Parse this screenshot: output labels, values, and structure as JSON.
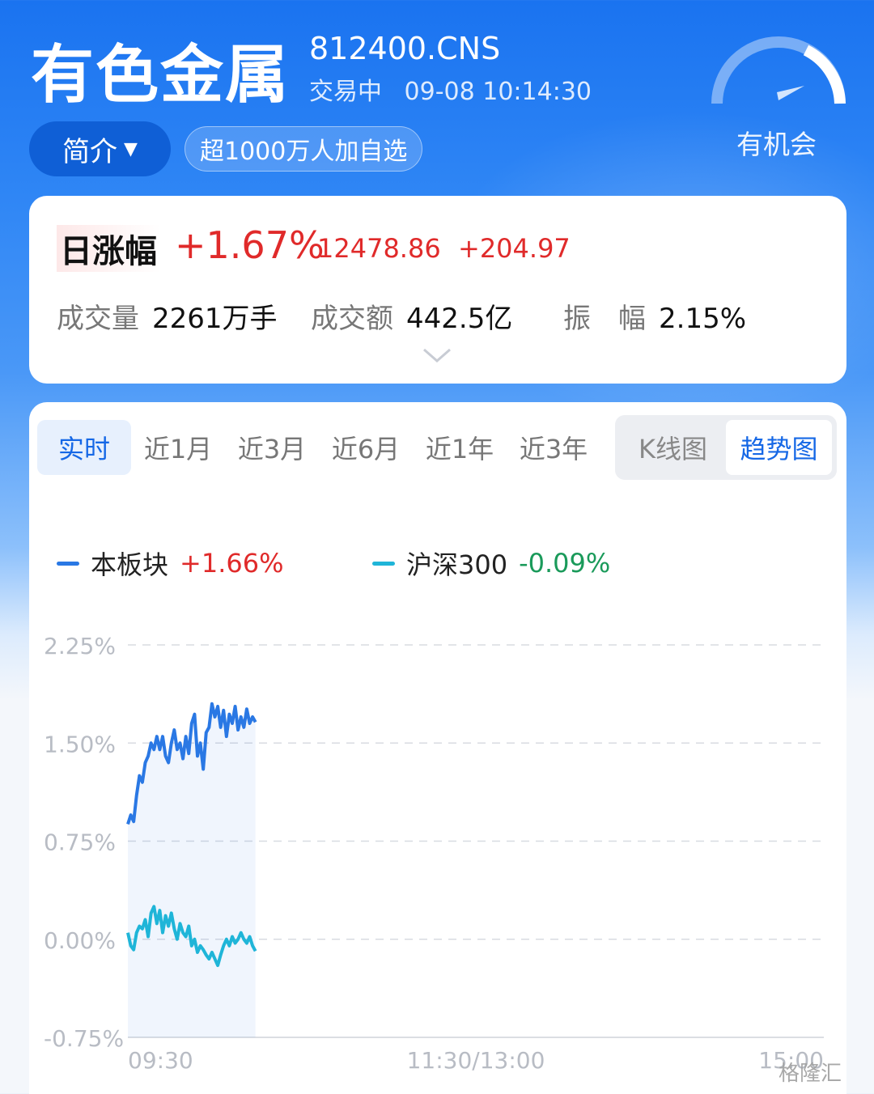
{
  "header": {
    "title": "有色金属",
    "code": "812400.CNS",
    "status": "交易中",
    "datetime": "09-08 10:14:30",
    "gauge_label": "有机会"
  },
  "actions": {
    "intro_label": "简介",
    "watchlist_label": "超1000万人加自选"
  },
  "summary": {
    "rise_label": "日涨幅",
    "rise_pct": "+1.67%",
    "price": "12478.86",
    "change": "+204.97",
    "volume_label": "成交量",
    "volume": "2261万手",
    "amount_label": "成交额",
    "amount": "442.5亿",
    "amplitude_label": "振　幅",
    "amplitude": "2.15%"
  },
  "tabs": [
    "实时",
    "近1月",
    "近3月",
    "近6月",
    "近1年",
    "近3年"
  ],
  "view_toggle": [
    "K线图",
    "趋势图"
  ],
  "legend": [
    {
      "name": "本板块",
      "pct": "+1.66%",
      "color": "#2a78e4",
      "pct_color": "#e02a2a"
    },
    {
      "name": "沪深300",
      "pct": "-0.09%",
      "color": "#1fb5d8",
      "pct_color": "#1a9a5a"
    }
  ],
  "colors": {
    "up": "#e02a2a",
    "down": "#1a9a5a",
    "accent": "#1668e6"
  },
  "watermark": "格隆汇",
  "chart_data": {
    "type": "line",
    "ylim": [
      -0.75,
      2.25
    ],
    "yticks": [
      "2.25%",
      "1.50%",
      "0.75%",
      "0.00%",
      "-0.75%"
    ],
    "ytick_values": [
      2.25,
      1.5,
      0.75,
      0.0,
      -0.75
    ],
    "xticks": [
      "09:30",
      "11:30/13:00",
      "15:00"
    ],
    "session_minutes": 240,
    "series": [
      {
        "name": "本板块",
        "color": "#2a78e4",
        "fill": true,
        "x": [
          0,
          1,
          2,
          3,
          4,
          5,
          6,
          7,
          8,
          9,
          10,
          11,
          12,
          13,
          14,
          15,
          16,
          17,
          18,
          19,
          20,
          21,
          22,
          23,
          24,
          25,
          26,
          27,
          28,
          29,
          30,
          31,
          32,
          33,
          34,
          35,
          36,
          37,
          38,
          39,
          40,
          41,
          42,
          43,
          44
        ],
        "values": [
          0.88,
          0.95,
          0.9,
          1.1,
          1.25,
          1.2,
          1.35,
          1.4,
          1.5,
          1.45,
          1.55,
          1.45,
          1.55,
          1.4,
          1.35,
          1.5,
          1.6,
          1.45,
          1.5,
          1.38,
          1.55,
          1.42,
          1.65,
          1.72,
          1.4,
          1.5,
          1.3,
          1.58,
          1.62,
          1.8,
          1.7,
          1.78,
          1.62,
          1.75,
          1.55,
          1.72,
          1.65,
          1.78,
          1.6,
          1.7,
          1.62,
          1.76,
          1.65,
          1.7,
          1.66
        ]
      },
      {
        "name": "沪深300",
        "color": "#1fb5d8",
        "fill": false,
        "x": [
          0,
          1,
          2,
          3,
          4,
          5,
          6,
          7,
          8,
          9,
          10,
          11,
          12,
          13,
          14,
          15,
          16,
          17,
          18,
          19,
          20,
          21,
          22,
          23,
          24,
          25,
          26,
          27,
          28,
          29,
          30,
          31,
          32,
          33,
          34,
          35,
          36,
          37,
          38,
          39,
          40,
          41,
          42,
          43,
          44
        ],
        "values": [
          0.05,
          -0.05,
          -0.08,
          0.05,
          0.1,
          0.08,
          0.15,
          0.02,
          0.2,
          0.25,
          0.12,
          0.22,
          0.05,
          0.18,
          0.1,
          0.2,
          0.08,
          0.0,
          0.12,
          0.05,
          0.02,
          0.1,
          -0.05,
          0.0,
          -0.1,
          -0.05,
          -0.08,
          -0.12,
          -0.15,
          -0.1,
          -0.15,
          -0.2,
          -0.12,
          -0.05,
          0.0,
          -0.05,
          0.02,
          -0.03,
          0.0,
          0.05,
          0.0,
          -0.03,
          0.02,
          -0.05,
          -0.09
        ]
      }
    ]
  }
}
